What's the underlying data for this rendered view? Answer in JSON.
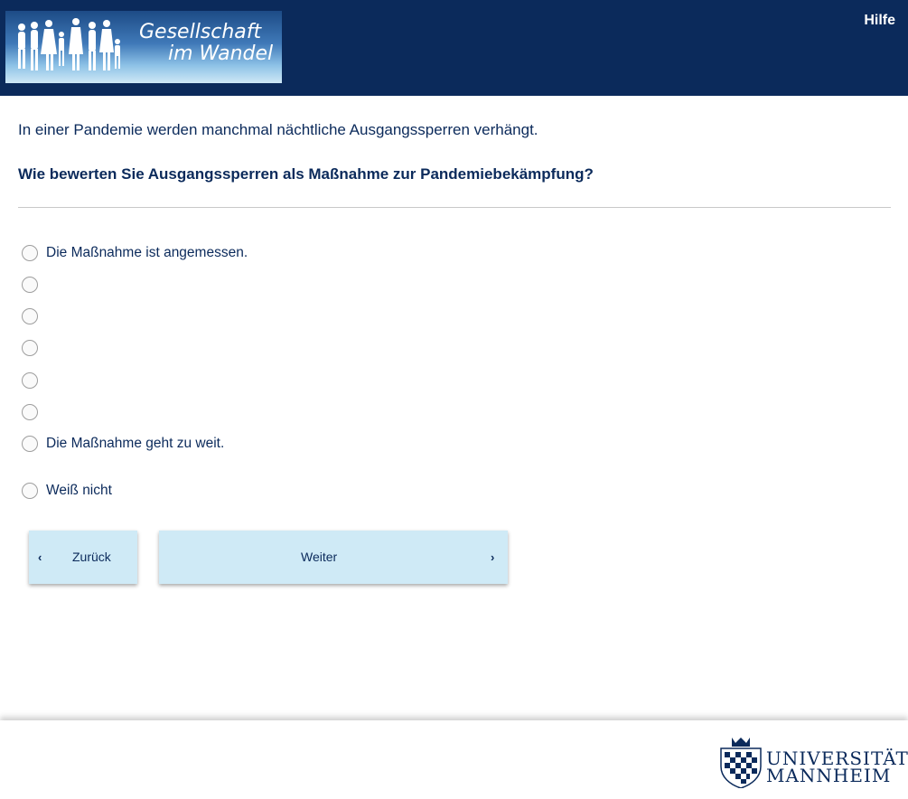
{
  "header": {
    "logo_line1": "Gesellschaft",
    "logo_line2": "im Wandel",
    "help_label": "Hilfe"
  },
  "survey": {
    "intro": "In einer Pandemie werden manchmal nächtliche Ausgangssperren verhängt.",
    "question": "Wie bewerten Sie Ausgangssperren als Maßnahme zur Pandemiebekämpfung?",
    "options": [
      "Die Maßnahme ist angemessen.",
      "",
      "",
      "",
      "",
      "",
      "Die Maßnahme geht zu weit."
    ],
    "dont_know": "Weiß nicht"
  },
  "nav": {
    "back_label": "Zurück",
    "back_icon": "chevron-left-icon",
    "next_label": "Weiter",
    "next_icon": "chevron-right-icon"
  },
  "footer": {
    "uni_line1": "UNIVERSITÄT",
    "uni_line2": "MANNHEIM"
  },
  "colors": {
    "header_bg": "#0b2a5b",
    "button_bg": "#cfeaf6",
    "text": "#0b2a5b"
  }
}
